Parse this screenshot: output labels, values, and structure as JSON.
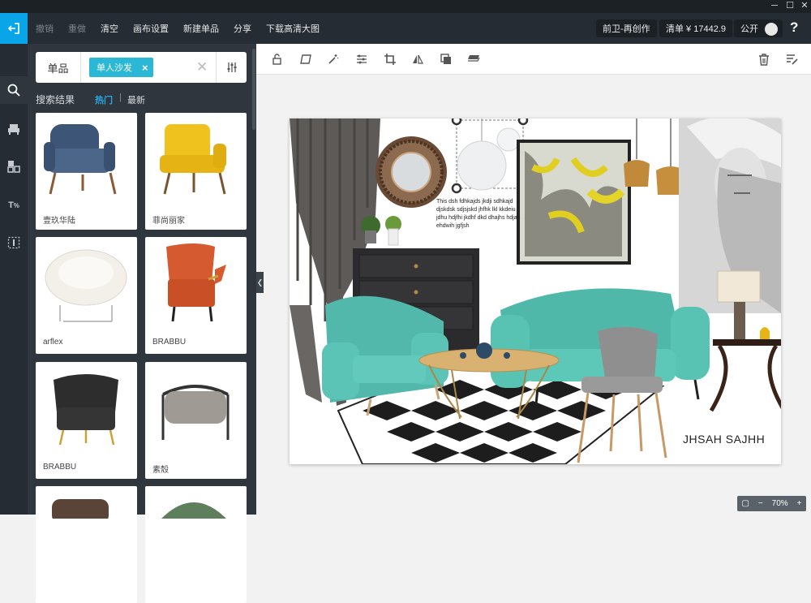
{
  "menu": {
    "undo": "撤销",
    "redo": "重做",
    "clear": "清空",
    "canvas_settings": "画布设置",
    "new_item": "新建单品",
    "share": "分享",
    "download": "下载高清大图"
  },
  "header": {
    "project": "前卫-再创作",
    "list_total": "清单 ¥ 17442.9",
    "public_label": "公开",
    "help": "?"
  },
  "window_controls": {
    "minimize": "─",
    "maximize": "☐",
    "close": "✕"
  },
  "search": {
    "type": "单品",
    "tag": "单人沙发",
    "tag_remove": "×",
    "clear": "✕"
  },
  "results": {
    "label": "搜索结果",
    "tab_hot": "热门",
    "separator": "|",
    "tab_new": "最新"
  },
  "cards": [
    {
      "label": "壹玖华陆",
      "color": "#3d5677"
    },
    {
      "label": "菲尚丽家",
      "color": "#f0c21d"
    },
    {
      "label": "arflex",
      "color": "#f3f0ea"
    },
    {
      "label": "BRABBU",
      "color": "#d55a2f"
    },
    {
      "label": "BRABBU",
      "color": "#2d2d2d"
    },
    {
      "label": "素殼",
      "color": "#a09a94"
    },
    {
      "label": "",
      "color": "#5a4438"
    },
    {
      "label": "",
      "color": "#5d7f5c"
    }
  ],
  "canvas": {
    "note": "This dsh  fdhkajds  jkdji  sdhkajd  djskdsk  sdjsjskd jhfhk lkl kkdeiu  jdhu  hdjfhi  jkdhf  dkd  dhajhs  hdjah  ehdwih  jgfjsh",
    "brand": "JHSAH   SAJHH"
  },
  "zoom": {
    "level": "70%",
    "minus": "−",
    "plus": "+"
  }
}
